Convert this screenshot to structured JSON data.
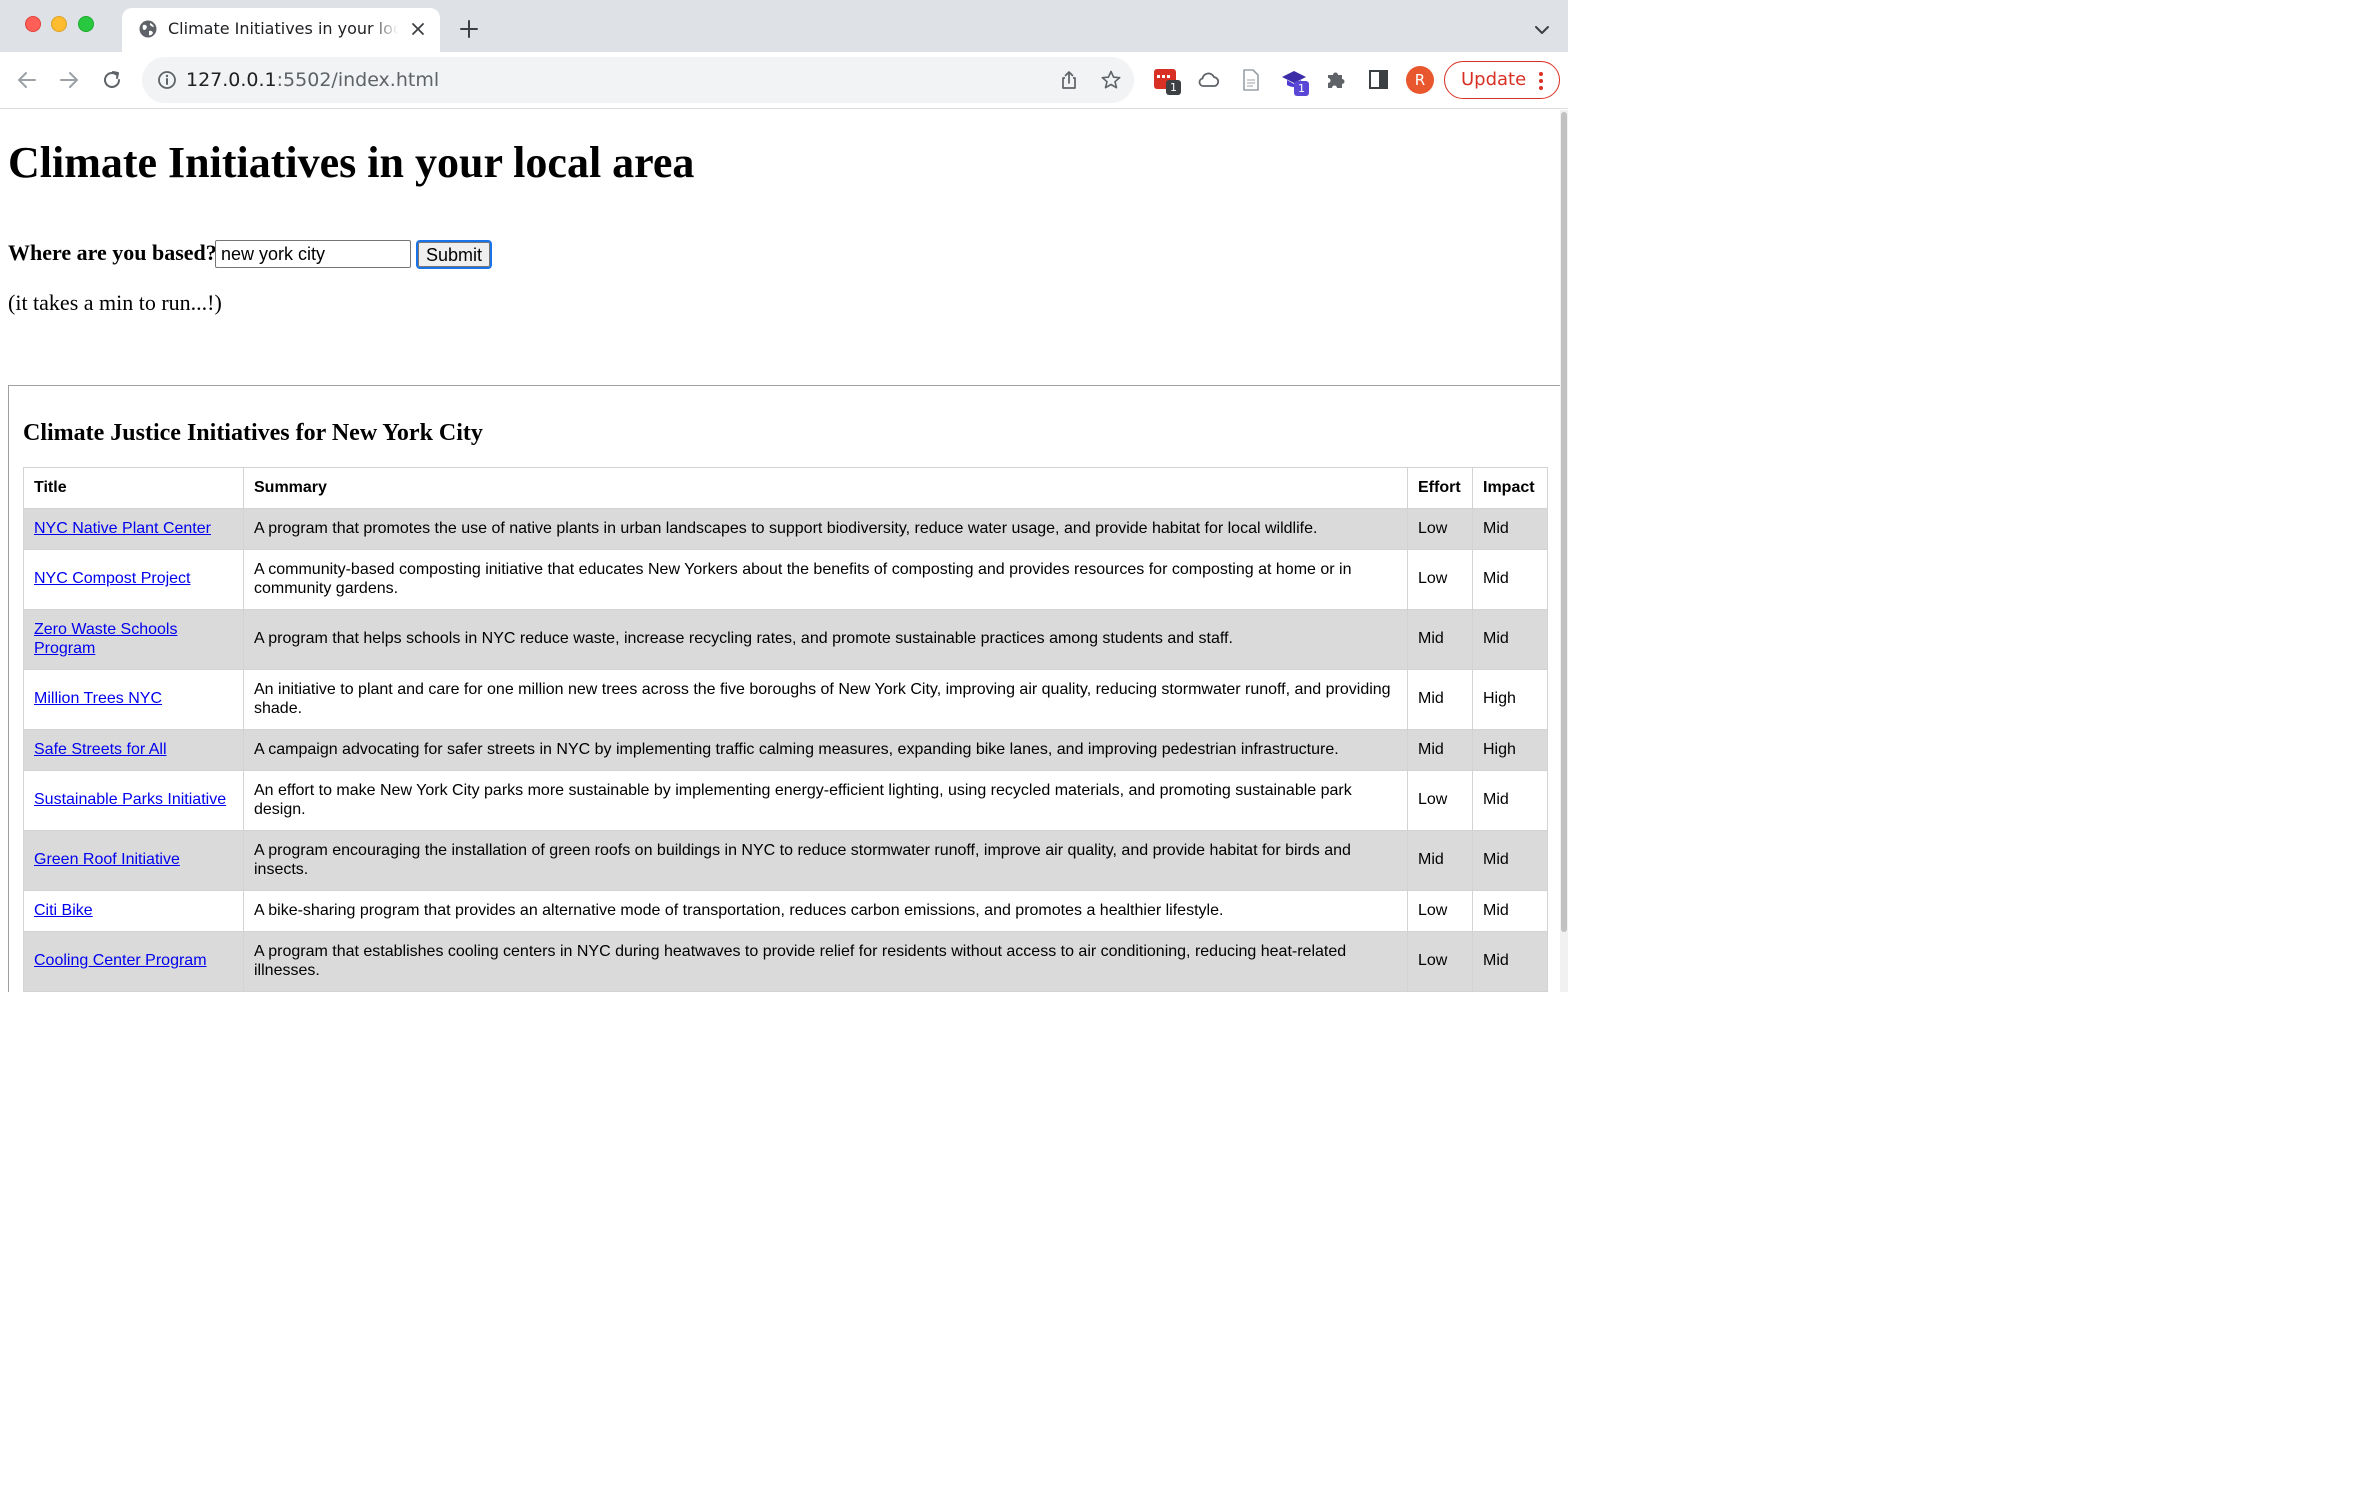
{
  "browser": {
    "tab_title": "Climate Initiatives in your local area",
    "url_host": "127.0.0.1",
    "url_rest": ":5502/index.html",
    "extension_badges": [
      "1",
      "1"
    ],
    "profile_initial": "R",
    "update_label": "Update"
  },
  "page": {
    "heading": "Climate Initiatives in your local area",
    "location_label": "Where are you based?",
    "location_value": "new york city",
    "submit_label": "Submit",
    "hint": "(it takes a min to run...!)",
    "results_title": "Climate Justice Initiatives for New York City"
  },
  "table": {
    "headers": [
      "Title",
      "Summary",
      "Effort",
      "Impact"
    ],
    "rows": [
      {
        "title": "NYC Native Plant Center",
        "summary": "A program that promotes the use of native plants in urban landscapes to support biodiversity, reduce water usage, and provide habitat for local wildlife.",
        "effort": "Low",
        "impact": "Mid"
      },
      {
        "title": "NYC Compost Project",
        "summary": "A community-based composting initiative that educates New Yorkers about the benefits of composting and provides resources for composting at home or in community gardens.",
        "effort": "Low",
        "impact": "Mid"
      },
      {
        "title": "Zero Waste Schools Program",
        "summary": "A program that helps schools in NYC reduce waste, increase recycling rates, and promote sustainable practices among students and staff.",
        "effort": "Mid",
        "impact": "Mid"
      },
      {
        "title": "Million Trees NYC",
        "summary": "An initiative to plant and care for one million new trees across the five boroughs of New York City, improving air quality, reducing stormwater runoff, and providing shade.",
        "effort": "Mid",
        "impact": "High"
      },
      {
        "title": "Safe Streets for All",
        "summary": "A campaign advocating for safer streets in NYC by implementing traffic calming measures, expanding bike lanes, and improving pedestrian infrastructure.",
        "effort": "Mid",
        "impact": "High"
      },
      {
        "title": "Sustainable Parks Initiative",
        "summary": "An effort to make New York City parks more sustainable by implementing energy-efficient lighting, using recycled materials, and promoting sustainable park design.",
        "effort": "Low",
        "impact": "Mid"
      },
      {
        "title": "Green Roof Initiative",
        "summary": "A program encouraging the installation of green roofs on buildings in NYC to reduce stormwater runoff, improve air quality, and provide habitat for birds and insects.",
        "effort": "Mid",
        "impact": "Mid"
      },
      {
        "title": "Citi Bike",
        "summary": "A bike-sharing program that provides an alternative mode of transportation, reduces carbon emissions, and promotes a healthier lifestyle.",
        "effort": "Low",
        "impact": "Mid"
      },
      {
        "title": "Cooling Center Program",
        "summary": "A program that establishes cooling centers in NYC during heatwaves to provide relief for residents without access to air conditioning, reducing heat-related illnesses.",
        "effort": "Low",
        "impact": "Mid"
      }
    ]
  }
}
